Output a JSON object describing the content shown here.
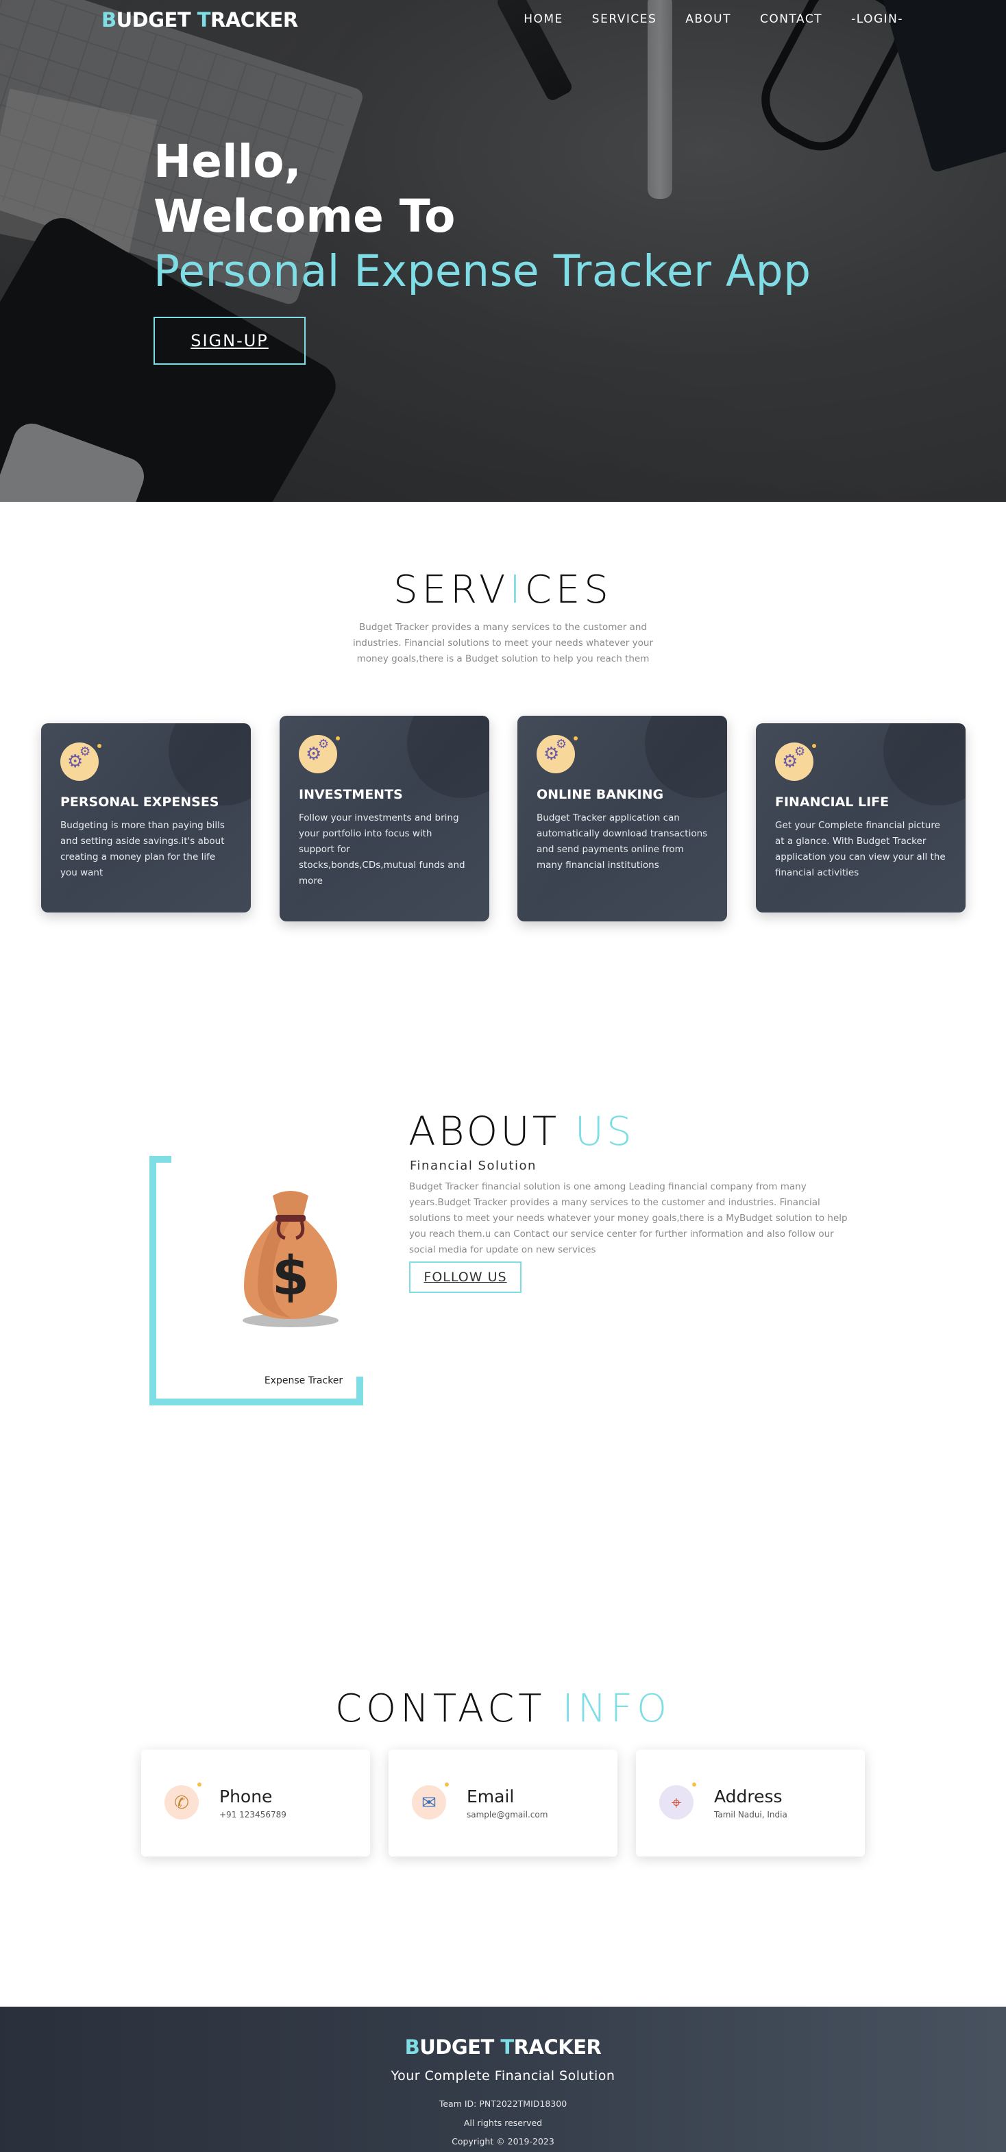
{
  "brand": {
    "first_letter": "B",
    "first_rest": "UDGET ",
    "second_letter": "T",
    "second_rest": "RACKER"
  },
  "nav": {
    "items": [
      {
        "label": "HOME"
      },
      {
        "label": "SERVICES"
      },
      {
        "label": "ABOUT"
      },
      {
        "label": "CONTACT"
      },
      {
        "label": "-LOGIN-"
      }
    ]
  },
  "hero": {
    "line1": "Hello,",
    "line2": "Welcome To",
    "line3": "Personal Expense Tracker App",
    "signup_label": "SIGN-UP"
  },
  "services": {
    "title_before": "SERV",
    "title_mid": "I",
    "title_after": "CES",
    "description": "Budget Tracker provides a many services to the customer and industries. Financial solutions to meet your needs whatever your money goals,there is a Budget solution to help you reach them",
    "cards": [
      {
        "title": "PERSONAL EXPENSES",
        "text": "Budgeting is more than paying bills and setting aside savings.it's about creating a money plan for the life you want"
      },
      {
        "title": "INVESTMENTS",
        "text": "Follow your investments and bring your portfolio into focus with support for stocks,bonds,CDs,mutual funds and more"
      },
      {
        "title": "ONLINE BANKING",
        "text": "Budget Tracker application can automatically download transactions and send payments online from many financial institutions"
      },
      {
        "title": "FINANCIAL LIFE",
        "text": "Get your Complete financial picture at a glance. With Budget Tracker application you can view your all the financial activities"
      }
    ]
  },
  "about": {
    "title": "ABOUT ",
    "title_accent": "US",
    "subtitle": "Financial Solution",
    "description": "Budget Tracker financial solution is one among Leading financial company from many years.Budget Tracker provides a many services to the customer and industries. Financial solutions to meet your needs whatever your money goals,there is a MyBudget solution to help you reach them.u can Contact our service center for further information and also follow our social media for update on new services",
    "follow_label": "FOLLOW US",
    "image_caption": "Expense Tracker",
    "image_symbol": "$"
  },
  "contact": {
    "title": "CONTACT ",
    "title_accent": "INFO",
    "cards": [
      {
        "title": "Phone",
        "value": "+91 123456789",
        "icon": "phone-icon",
        "glyph": "✆",
        "bg": "#fde1d3"
      },
      {
        "title": "Email",
        "value": "sample@gmail.com",
        "icon": "email-icon",
        "glyph": "✉",
        "bg": "#fde1d3"
      },
      {
        "title": "Address",
        "value": "Tamil Nadui, India",
        "icon": "map-icon",
        "glyph": "⌖",
        "bg": "#e9e4f5"
      }
    ]
  },
  "footer": {
    "tagline": "Your Complete Financial Solution",
    "team_id": "Team ID: PNT2022TMID18300",
    "rights": "All rights reserved",
    "copyright": "Copyright © 2019-2023"
  },
  "colors": {
    "accent": "#7fdde6",
    "card_bg": "#3c4452",
    "footer_bg": "#353d4a"
  }
}
